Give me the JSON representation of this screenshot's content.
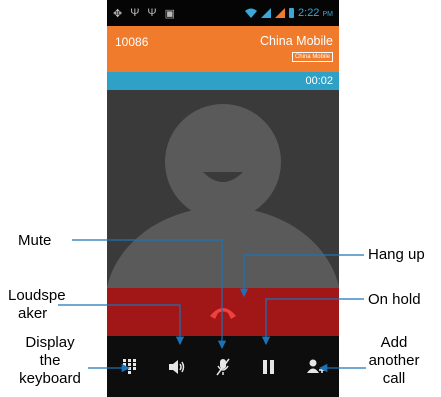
{
  "status_bar": {
    "time": "2:22",
    "ampm": "PM",
    "icons": [
      "usb-icon",
      "usb-icon",
      "usb-icon",
      "sd-card-icon",
      "wifi-icon",
      "signal-icon",
      "signal-icon",
      "battery-icon"
    ]
  },
  "call": {
    "number": "10086",
    "carrier": "China Mobile",
    "carrier_badge": "China Mobile",
    "timer": "00:02"
  },
  "controls": {
    "icons": [
      "dialpad-icon",
      "speaker-icon",
      "mute-mic-icon",
      "pause-icon",
      "add-contact-icon"
    ]
  },
  "annotations": {
    "mute": "Mute",
    "loudspeaker_1": "Loudspe",
    "loudspeaker_2": "aker",
    "keyboard_1": "Display",
    "keyboard_2": "the",
    "keyboard_3": "keyboard",
    "hang_up": "Hang up",
    "on_hold": "On hold",
    "add_call_1": "Add",
    "add_call_2": "another",
    "add_call_3": "call"
  },
  "colors": {
    "header": "#f07b2d",
    "timer_bar": "#2fa0c6",
    "end_bar": "#a11616",
    "status_icons": "#3aa8d8"
  }
}
